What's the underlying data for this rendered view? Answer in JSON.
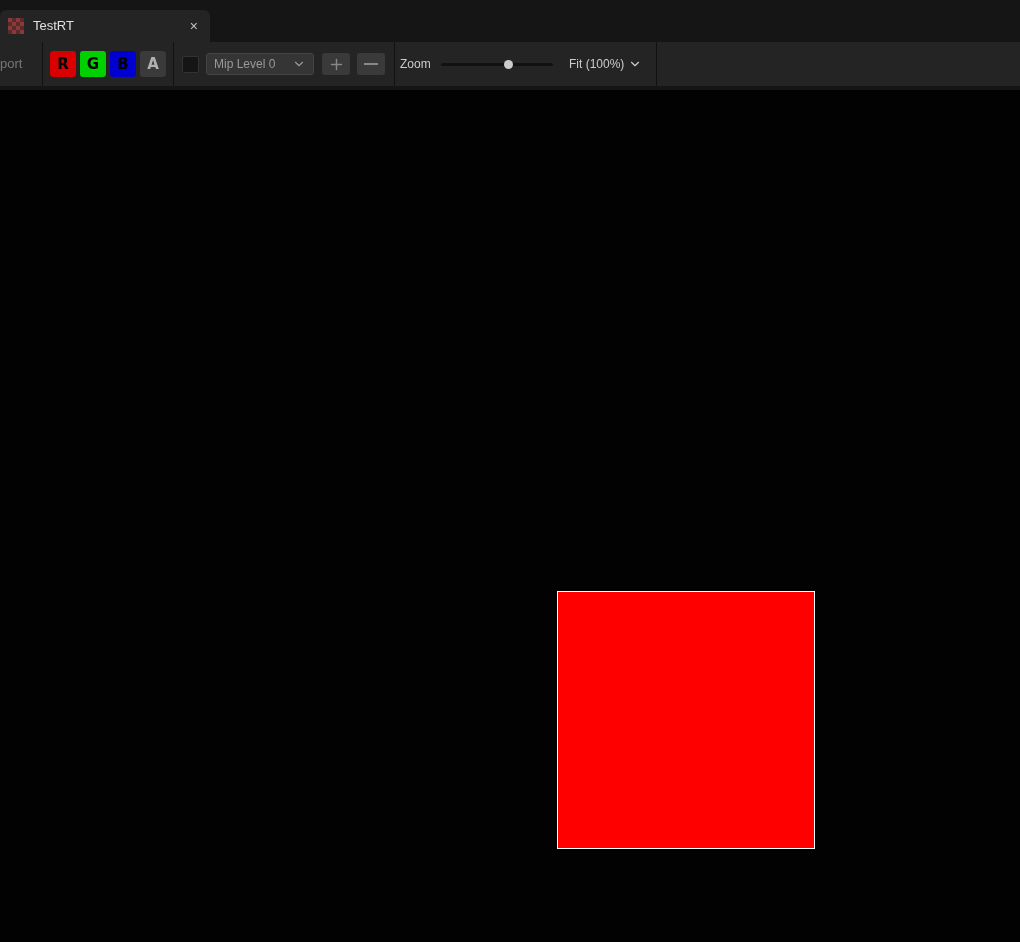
{
  "tab": {
    "title": "TestRT",
    "close": "×"
  },
  "toolbar": {
    "cut_label": {
      "text": "port",
      "disabled": true
    },
    "channels": [
      {
        "label": "R",
        "on": true,
        "color": "#d80000"
      },
      {
        "label": "G",
        "on": true,
        "color": "#00d000"
      },
      {
        "label": "B",
        "on": true,
        "color": "#0000d0"
      },
      {
        "label": "A",
        "on": false,
        "color": "#b0b0b0"
      }
    ],
    "mip_checkbox": {
      "checked": false
    },
    "mip_dropdown": {
      "value": "Mip Level 0"
    },
    "zoom": {
      "label": "Zoom",
      "level": 0.6,
      "fit": "Fit (100%)"
    }
  }
}
